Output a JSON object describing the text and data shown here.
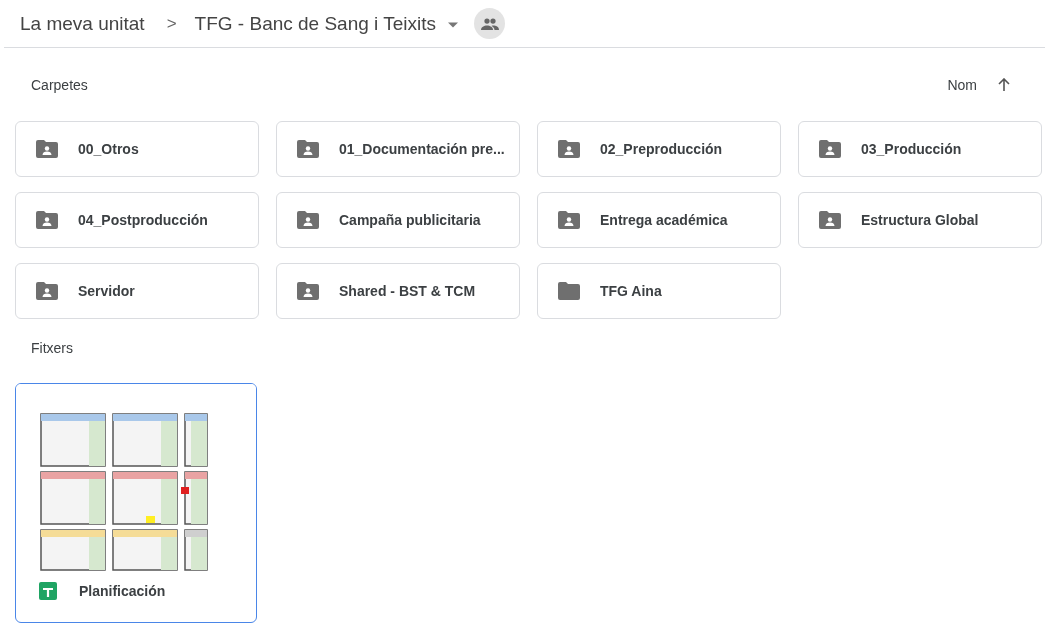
{
  "breadcrumb": {
    "root": "La meva unitat",
    "separator": ">",
    "current": "TFG - Banc de Sang i Teixits"
  },
  "folders_section": {
    "title": "Carpetes",
    "sort": {
      "label": "Nom",
      "ascending": true
    }
  },
  "folders": [
    {
      "name": "00_Otros",
      "shared": true
    },
    {
      "name": "01_Documentación pre...",
      "shared": true
    },
    {
      "name": "02_Preproducción",
      "shared": true
    },
    {
      "name": "03_Producción",
      "shared": true
    },
    {
      "name": "04_Postproducción",
      "shared": true
    },
    {
      "name": "Campaña publicitaria",
      "shared": true
    },
    {
      "name": "Entrega académica",
      "shared": true
    },
    {
      "name": "Estructura Global",
      "shared": true
    },
    {
      "name": "Servidor",
      "shared": true
    },
    {
      "name": "Shared - BST & TCM",
      "shared": true
    },
    {
      "name": "TFG Aina",
      "shared": false
    }
  ],
  "files_section": {
    "title": "Fitxers"
  },
  "files": [
    {
      "name": "Planificación",
      "kind": "spreadsheet",
      "selected": true
    }
  ]
}
